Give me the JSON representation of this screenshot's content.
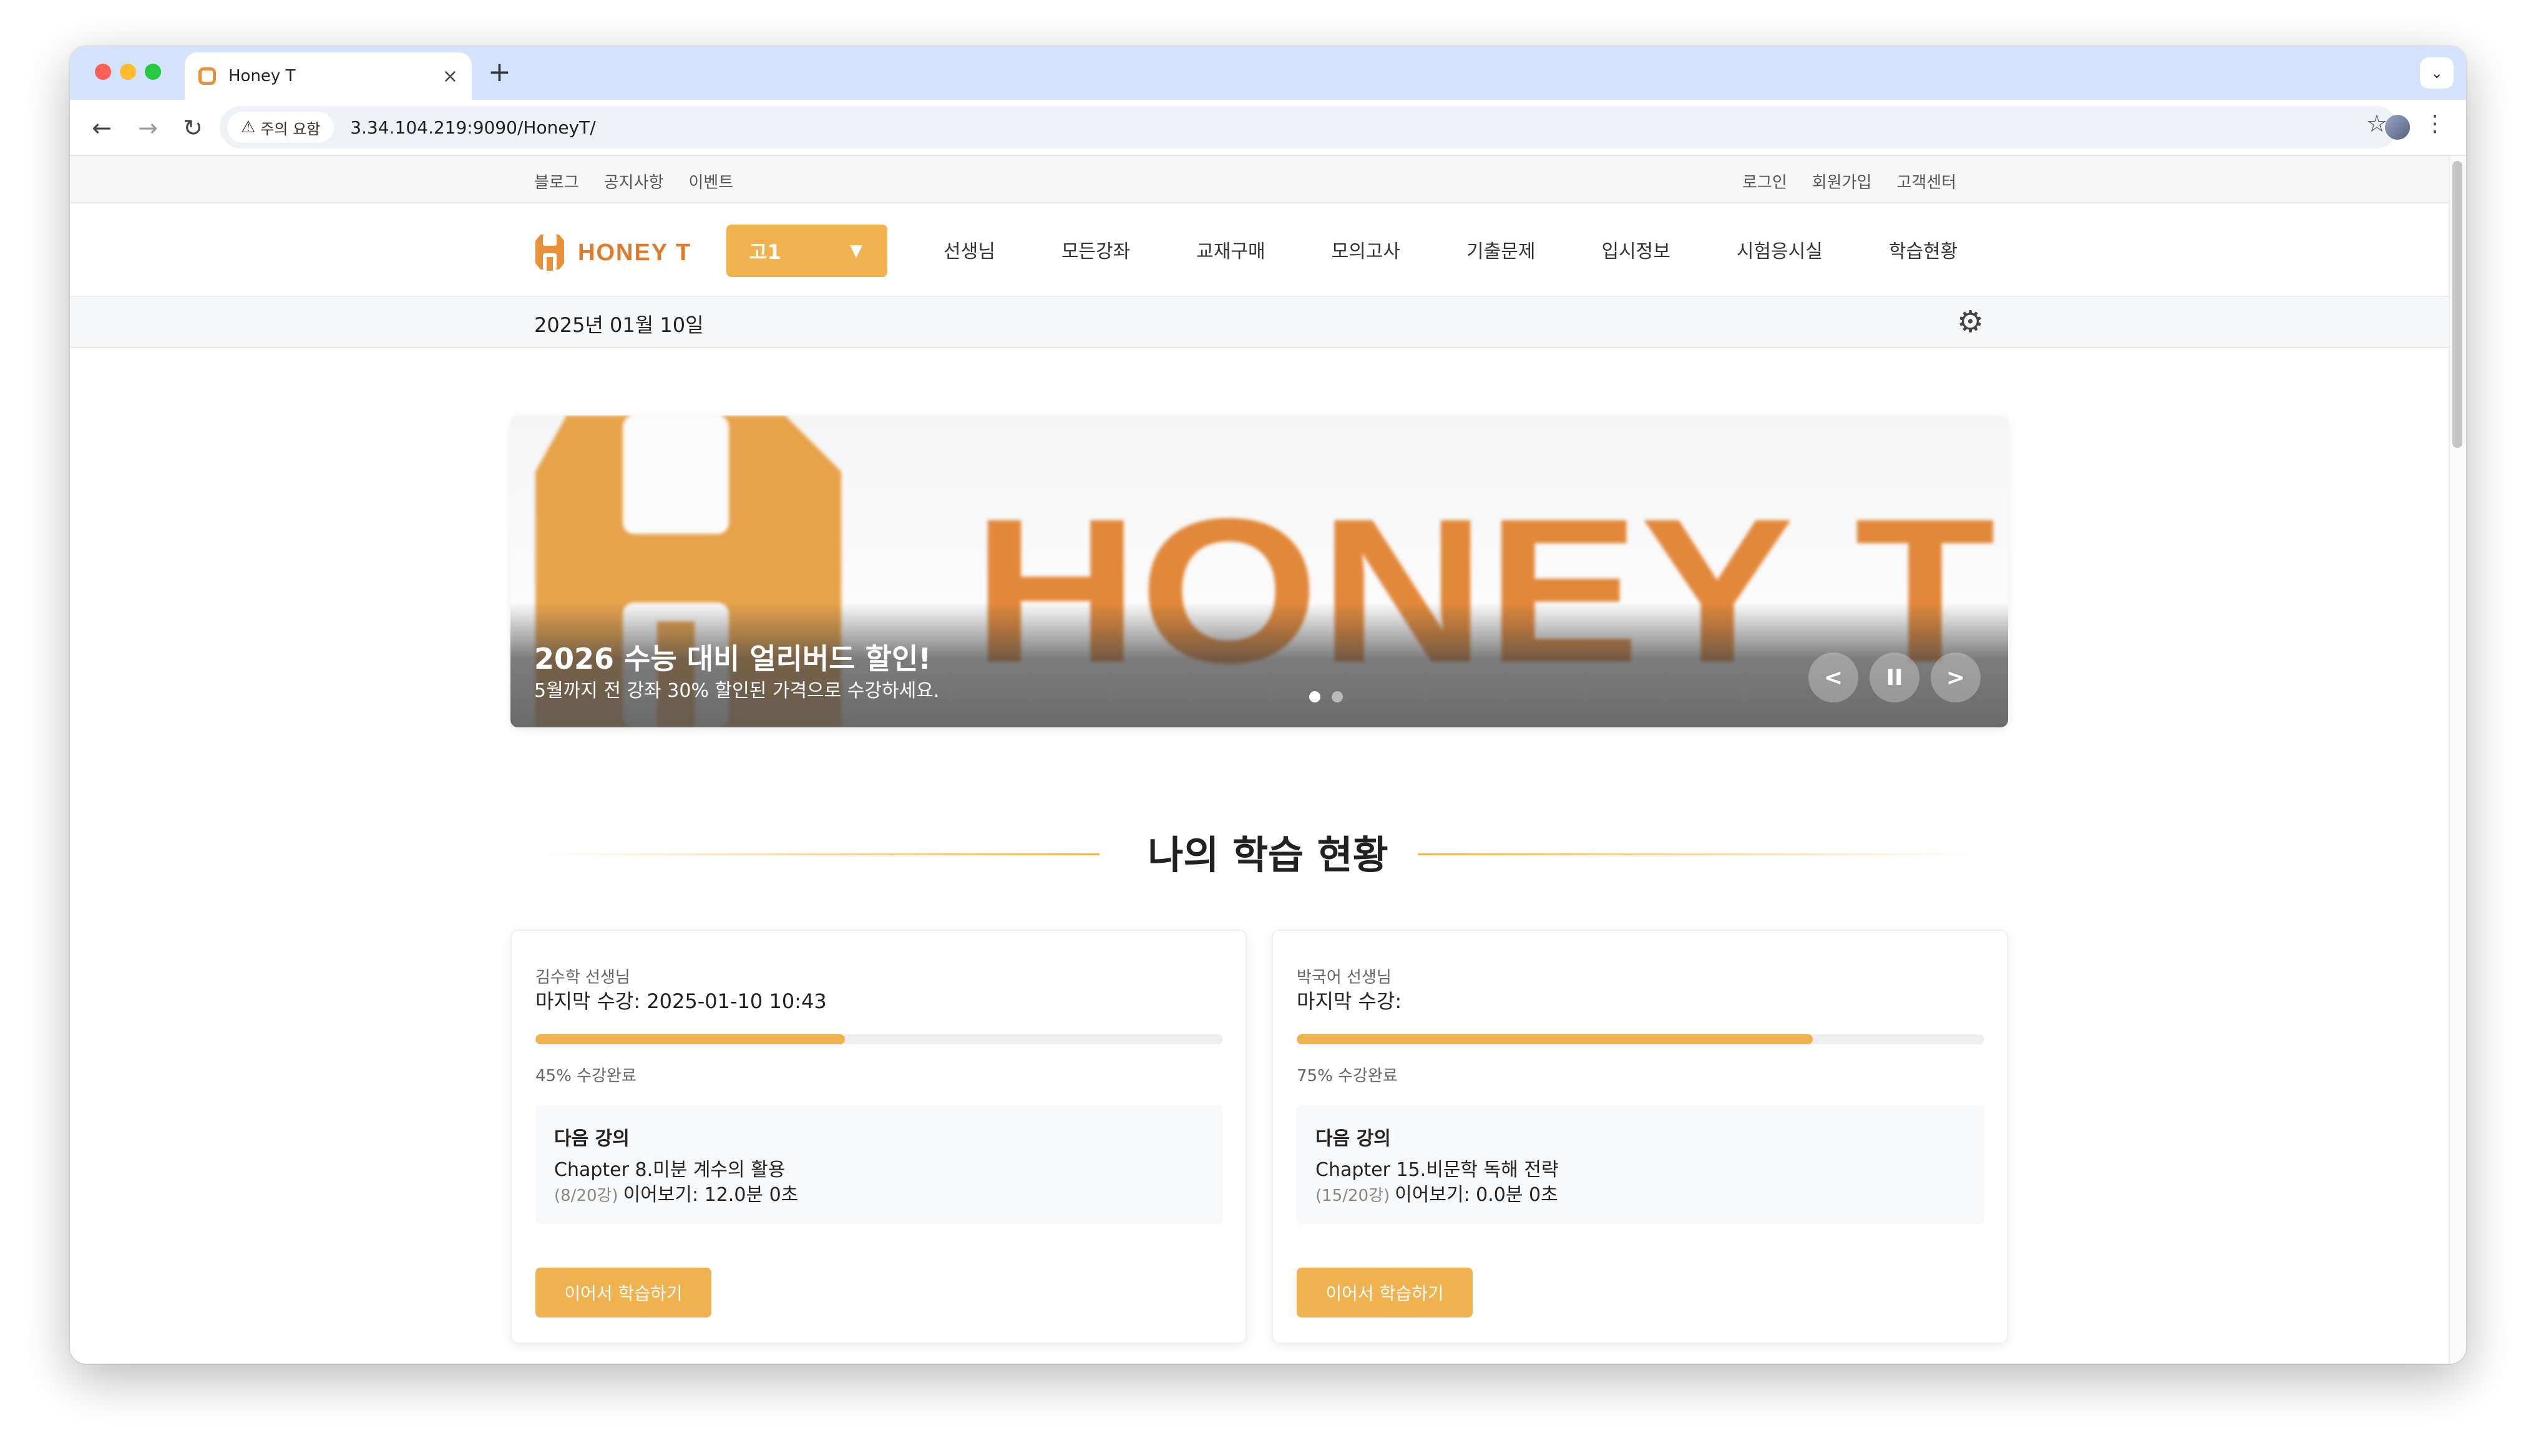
{
  "browser": {
    "tab_title": "Honey T",
    "new_tab": "+",
    "close": "×",
    "security_label": "주의 요함",
    "url": "3.34.104.219:9090/HoneyT/"
  },
  "util": {
    "left": [
      "블로그",
      "공지사항",
      "이벤트"
    ],
    "right": [
      "로그인",
      "회원가입",
      "고객센터"
    ]
  },
  "logo": {
    "text": "HONEY T"
  },
  "grade": {
    "selected": "고1",
    "arrow": "▼"
  },
  "nav": [
    "선생님",
    "모든강좌",
    "교재구매",
    "모의고사",
    "기출문제",
    "입시정보",
    "시험응시실",
    "학습현황"
  ],
  "date": "2025년 01월 10일",
  "banner": {
    "art_text": "HONEY T",
    "title": "2026 수능 대비 얼리버드 할인!",
    "subtitle": "5월까지 전 강좌 30% 할인된 가격으로 수강하세요.",
    "slides": 2,
    "active_slide": 0,
    "prev": "<",
    "pause": "II",
    "next": ">"
  },
  "section": {
    "title": "나의 학습 현황"
  },
  "cards": [
    {
      "teacher": "김수학 선생님",
      "last_watch": "마지막 수강: 2025-01-10 10:43",
      "progress": 45,
      "progress_label": "45% 수강완료",
      "next_heading": "다음 강의",
      "next_chapter": "Chapter 8.미분 계수의 활용",
      "next_count": "(8/20강)",
      "resume": "이어보기: 12.0분 0초",
      "button": "이어서 학습하기"
    },
    {
      "teacher": "박국어 선생님",
      "last_watch": "마지막 수강:",
      "progress": 75,
      "progress_label": "75% 수강완료",
      "next_heading": "다음 강의",
      "next_chapter": "Chapter 15.비문학 독해 전략",
      "next_count": "(15/20강)",
      "resume": "이어보기: 0.0분 0초",
      "button": "이어서 학습하기"
    }
  ],
  "colors": {
    "accent": "#f0b24e",
    "brand_orange": "#e07a2a",
    "tabstrip": "#d3e3fd"
  },
  "icons": {
    "back": "arrow-left-icon",
    "forward": "arrow-right-icon",
    "reload": "reload-icon",
    "bookmark": "star-icon",
    "settings": "gear-icon"
  }
}
